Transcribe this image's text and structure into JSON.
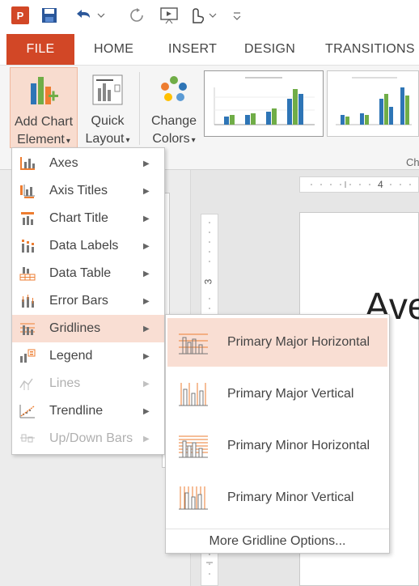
{
  "qat": {
    "app_logo": "P",
    "icons": [
      "powerpoint-logo",
      "save-icon",
      "undo-icon",
      "redo-icon",
      "start-presentation-icon",
      "touch-mode-icon",
      "customize-icon"
    ]
  },
  "tabs": {
    "file": "FILE",
    "home": "HOME",
    "insert": "INSERT",
    "design": "DESIGN",
    "transitions": "TRANSITIONS"
  },
  "ribbon": {
    "add_chart_element": {
      "line1": "Add Chart",
      "line2": "Element",
      "caret": "▾"
    },
    "quick_layout": {
      "line1": "Quick",
      "line2": "Layout",
      "caret": "▾"
    },
    "change_colors": {
      "line1": "Change",
      "line2": "Colors",
      "caret": "▾"
    },
    "group_label_partial": "Ch"
  },
  "document": {
    "ruler_h_number": "4",
    "ruler_v_number": "3",
    "slide_title_partial": "Ave"
  },
  "menu": {
    "items": [
      {
        "label": "Axes",
        "icon": "axes-icon",
        "has_submenu": true,
        "enabled": true
      },
      {
        "label": "Axis Titles",
        "icon": "axis-titles-icon",
        "has_submenu": true,
        "enabled": true
      },
      {
        "label": "Chart Title",
        "icon": "chart-title-icon",
        "has_submenu": true,
        "enabled": true
      },
      {
        "label": "Data Labels",
        "icon": "data-labels-icon",
        "has_submenu": true,
        "enabled": true
      },
      {
        "label": "Data Table",
        "icon": "data-table-icon",
        "has_submenu": true,
        "enabled": true
      },
      {
        "label": "Error Bars",
        "icon": "error-bars-icon",
        "has_submenu": true,
        "enabled": true
      },
      {
        "label": "Gridlines",
        "icon": "gridlines-icon",
        "has_submenu": true,
        "enabled": true,
        "active": true
      },
      {
        "label": "Legend",
        "icon": "legend-icon",
        "has_submenu": true,
        "enabled": true
      },
      {
        "label": "Lines",
        "icon": "lines-icon",
        "has_submenu": true,
        "enabled": false
      },
      {
        "label": "Trendline",
        "icon": "trendline-icon",
        "has_submenu": true,
        "enabled": true
      },
      {
        "label": "Up/Down Bars",
        "icon": "up-down-bars-icon",
        "has_submenu": true,
        "enabled": false
      }
    ]
  },
  "submenu": {
    "items": [
      {
        "label": "Primary Major Horizontal",
        "icon": "primary-major-horizontal-icon",
        "active": true
      },
      {
        "label": "Primary Major Vertical",
        "icon": "primary-major-vertical-icon"
      },
      {
        "label": "Primary Minor Horizontal",
        "icon": "primary-minor-horizontal-icon"
      },
      {
        "label": "Primary Minor Vertical",
        "icon": "primary-minor-vertical-icon"
      }
    ],
    "more_options": "More Gridline Options..."
  },
  "colors": {
    "accent": "#d24726",
    "highlight": "#f9ded3",
    "chart_blue": "#2e75b6",
    "chart_green": "#70ad47",
    "chart_orange": "#ed7d31"
  }
}
